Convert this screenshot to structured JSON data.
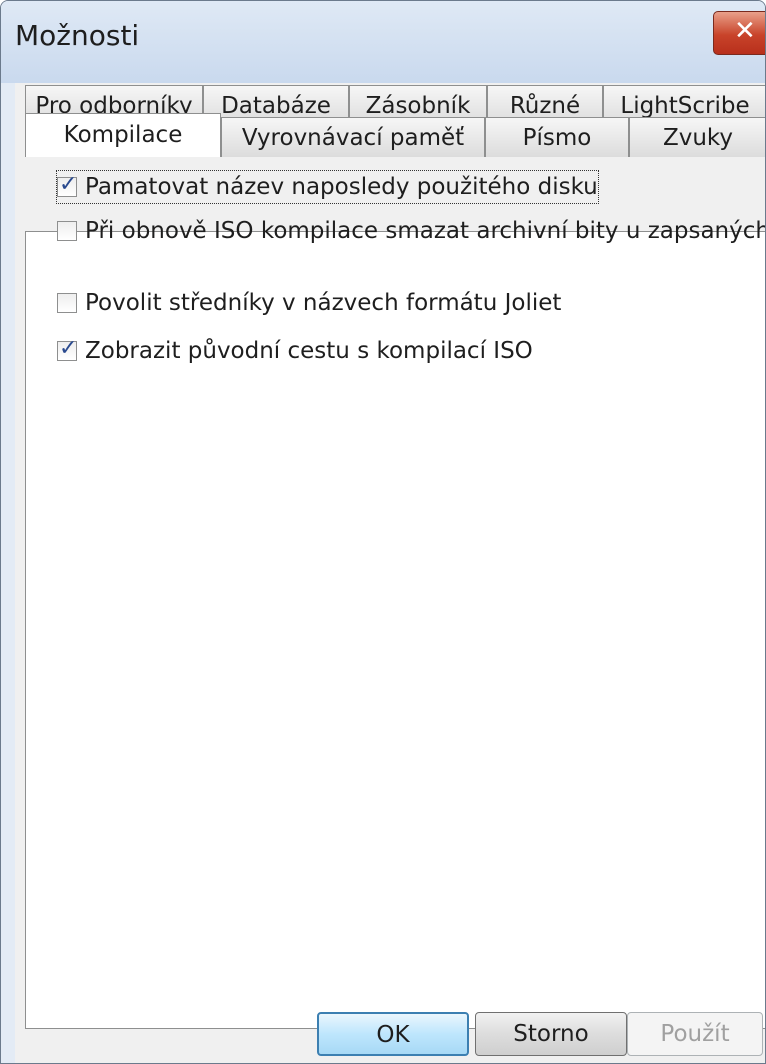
{
  "window": {
    "title": "Možnosti",
    "close_label": "✕"
  },
  "tabs": {
    "row_top": [
      "Pro odborníky",
      "Databáze",
      "Zásobník",
      "Různé",
      "LightScribe"
    ],
    "row_bottom": [
      "Kompilace",
      "Vyrovnávací paměť",
      "Písmo",
      "Zvuky"
    ],
    "active": "Kompilace"
  },
  "options": [
    {
      "label": "Pamatovat název naposledy použitého disku",
      "checked": true
    },
    {
      "label": "Při obnově ISO kompilace smazat archivní bity u zapsaných souborů",
      "checked": false
    },
    {
      "label": "Povolit středníky v názvech formátu Joliet",
      "checked": false
    },
    {
      "label": "Zobrazit původní cestu s kompilací ISO",
      "checked": true
    }
  ],
  "buttons": {
    "ok": "OK",
    "cancel": "Storno",
    "apply": "Použít"
  }
}
